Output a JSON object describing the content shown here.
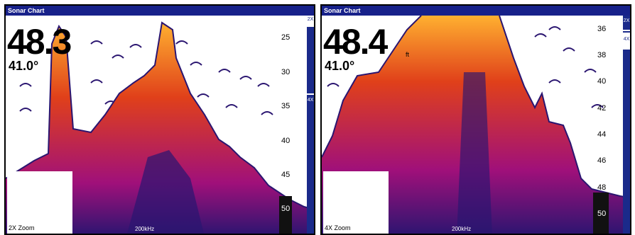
{
  "left": {
    "title": "Sonar Chart",
    "depth": "48.3",
    "depth_unit": "",
    "temperature": "41.0°",
    "zoom": "2X Zoom",
    "frequency": "200kHz",
    "zoombar_label_top": "2X",
    "zoombar_label_mid": "4X",
    "scale": [
      "25",
      "30",
      "35",
      "40",
      "45",
      "50"
    ]
  },
  "right": {
    "title": "Sonar Chart",
    "depth": "48.4",
    "depth_unit": "ft",
    "temperature": "41.0°",
    "zoom": "4X Zoom",
    "frequency": "200kHz",
    "zoombar_label_top": "2X",
    "zoombar_label_mid": "4X",
    "scale": [
      "36",
      "38",
      "40",
      "42",
      "44",
      "46",
      "48",
      "50"
    ]
  },
  "colors": {
    "titlebar": "#17218a",
    "sonar_dark": "#2a1570",
    "sonar_mid": "#a0107a",
    "sonar_hot": "#e0401a",
    "sonar_bright": "#ffb030"
  }
}
